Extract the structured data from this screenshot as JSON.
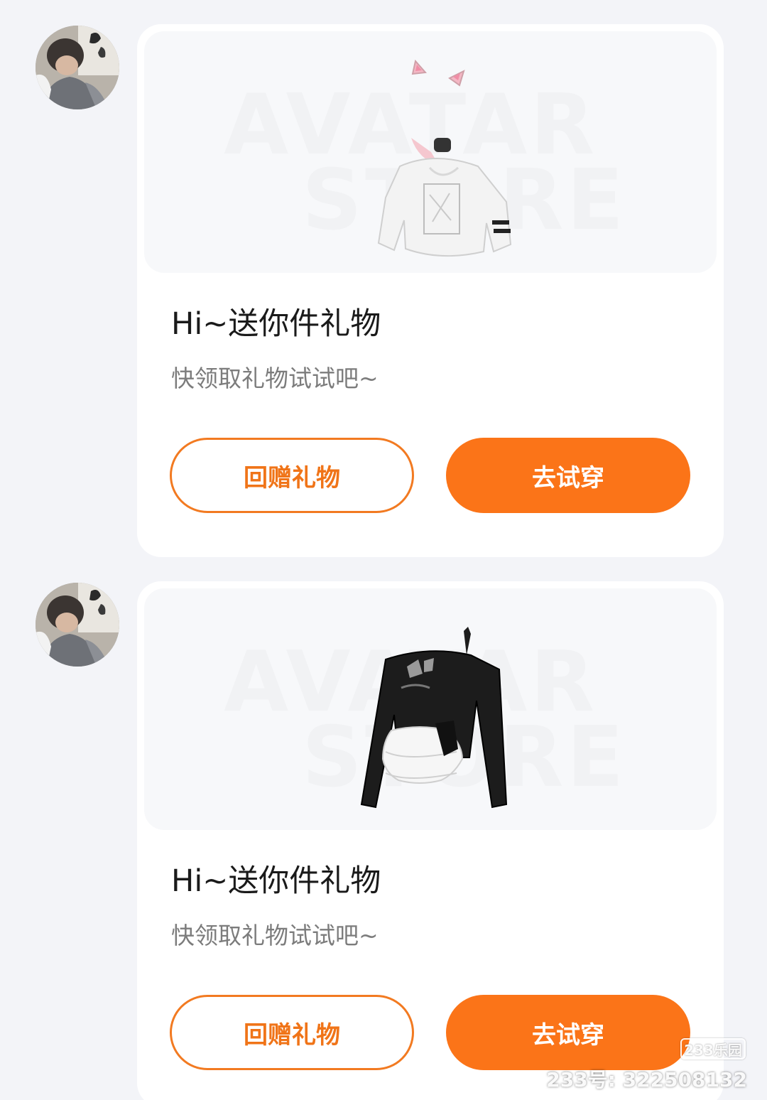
{
  "messages": [
    {
      "title": "Hi~送你件礼物",
      "subtitle": "快领取礼物试试吧~",
      "watermark": [
        "AVATAR",
        "STORE"
      ],
      "item_icon": "white-cat-ear-sweater",
      "buttons": {
        "return_gift": "回赠礼物",
        "try_on": "去试穿"
      }
    },
    {
      "title": "Hi~送你件礼物",
      "subtitle": "快领取礼物试试吧~",
      "watermark": [
        "AVATAR",
        "STORE"
      ],
      "item_icon": "black-ruffle-dress",
      "buttons": {
        "return_gift": "回赠礼物",
        "try_on": "去试穿"
      }
    }
  ],
  "site_watermark": {
    "logo": "233乐园",
    "id_text": "233号: 322508132"
  },
  "colors": {
    "accent": "#fb7418",
    "page_bg": "#f3f4f8",
    "card_bg": "#ffffff"
  }
}
